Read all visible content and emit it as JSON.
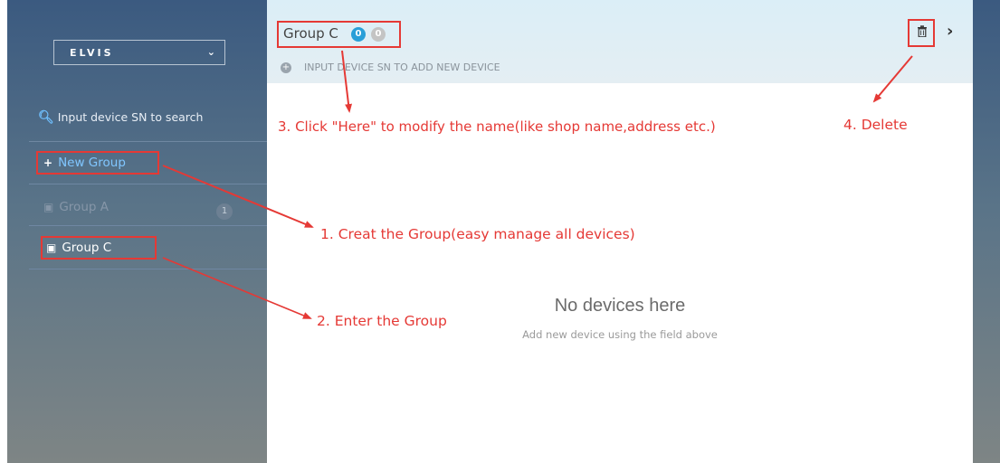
{
  "sidebar": {
    "account_name": "ELVIS",
    "search_placeholder": "Input device SN to search",
    "new_group_label": "New Group",
    "groups": [
      {
        "label": "Group A",
        "count": "1"
      },
      {
        "label": "Group C"
      }
    ]
  },
  "main": {
    "title": "Group C",
    "device_count_online": "0",
    "device_count_offline": "0",
    "add_device_placeholder": "INPUT DEVICE SN TO ADD NEW DEVICE",
    "empty_title": "No devices here",
    "empty_subtitle": "Add new device using the field above"
  },
  "annotations": {
    "step1": "1. Creat the Group(easy manage all devices)",
    "step2": "2. Enter the Group",
    "step3": "3. Click \"Here\" to modify the name(like shop name,address etc.)",
    "step4": "4. Delete"
  },
  "icons": [
    "search-icon",
    "chevron-down-icon",
    "plus-icon",
    "group-icon",
    "add-circle-icon",
    "trash-icon",
    "chevron-right-icon"
  ],
  "colors": {
    "accent_blue": "#2a9fd8",
    "annotation_red": "#e53935",
    "link_blue": "#80c6ff"
  }
}
